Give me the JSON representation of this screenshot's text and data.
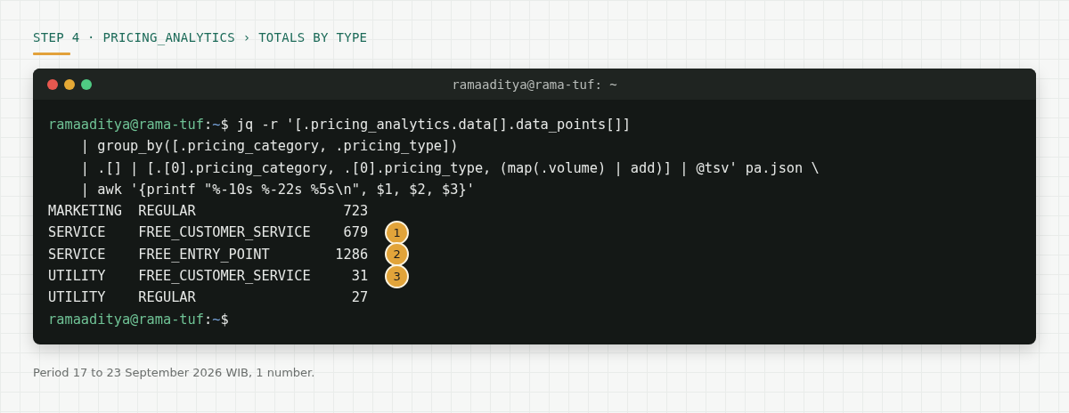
{
  "heading": "STEP 4 · PRICING_ANALYTICS › TOTALS BY TYPE",
  "terminal": {
    "title": "ramaaditya@rama-tuf: ~",
    "lines": [
      {
        "kind": "command",
        "user_host": "ramaaditya@rama-tuf",
        "separator": ":",
        "path": "~",
        "symbol": "$",
        "text": "jq -r '[.pricing_analytics.data[].data_points[]]"
      },
      {
        "kind": "continuation",
        "text": "    | group_by([.pricing_category, .pricing_type])"
      },
      {
        "kind": "continuation",
        "text": "    | .[] | [.[0].pricing_category, .[0].pricing_type, (map(.volume) | add)] | @tsv' pa.json \\"
      },
      {
        "kind": "continuation",
        "text": "    | awk '{printf \"%-10s %-22s %5s\\n\", $1, $2, $3}'"
      },
      {
        "kind": "output",
        "text": "MARKETING  REGULAR                  723"
      },
      {
        "kind": "output",
        "text": "SERVICE    FREE_CUSTOMER_SERVICE    679",
        "badge": "1"
      },
      {
        "kind": "output",
        "text": "SERVICE    FREE_ENTRY_POINT        1286",
        "badge": "2"
      },
      {
        "kind": "output",
        "text": "UTILITY    FREE_CUSTOMER_SERVICE     31",
        "badge": "3"
      },
      {
        "kind": "output",
        "text": "UTILITY    REGULAR                   27"
      },
      {
        "kind": "prompt",
        "user_host": "ramaaditya@rama-tuf",
        "separator": ":",
        "path": "~",
        "symbol": "$"
      }
    ]
  },
  "caption": "Period 17 to 23 September 2026 WIB, 1 number."
}
